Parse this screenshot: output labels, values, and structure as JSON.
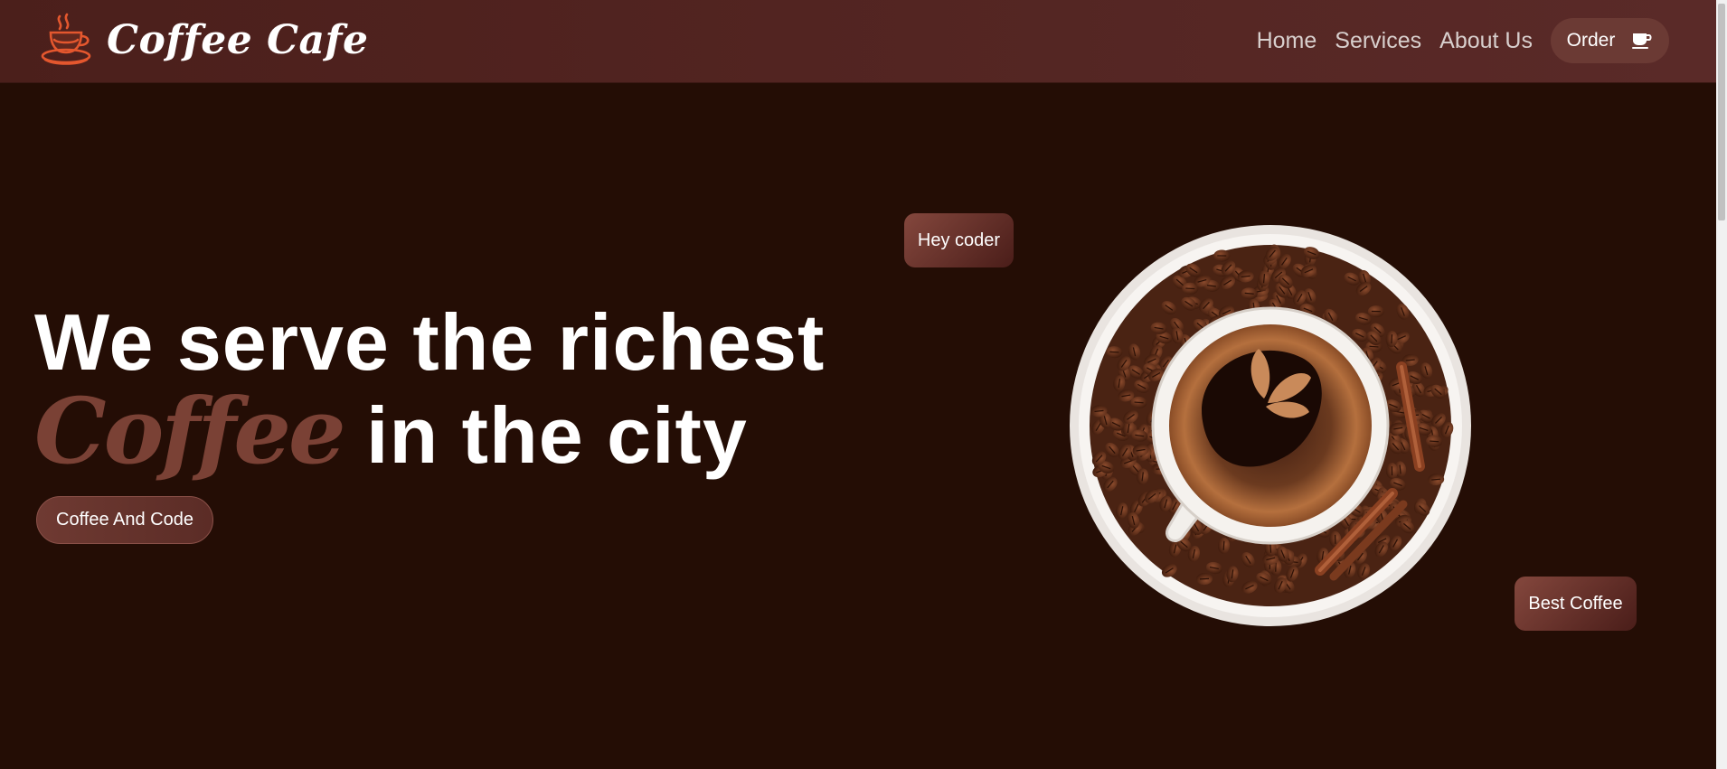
{
  "brand": {
    "name": "Coffee Cafe",
    "logo_icon": "coffee-cup-logo-icon",
    "logo_color": "#e4572e"
  },
  "nav": {
    "links": [
      "Home",
      "Services",
      "About Us"
    ],
    "order_label": "Order",
    "order_icon": "coffee-cup-icon"
  },
  "hero": {
    "title_line1": "We serve the richest",
    "title_accent": "Coffee",
    "title_line2_rest": " in the city",
    "button_label": "Coffee And Code",
    "accent_color": "#7a4135"
  },
  "badges": {
    "top": "Hey coder",
    "bottom": "Best Coffee"
  },
  "image": {
    "subject": "coffee-cup-on-beans-image"
  },
  "colors": {
    "background": "#240d05",
    "navbar": "#4b1f1b",
    "button": "#6b3a34"
  }
}
